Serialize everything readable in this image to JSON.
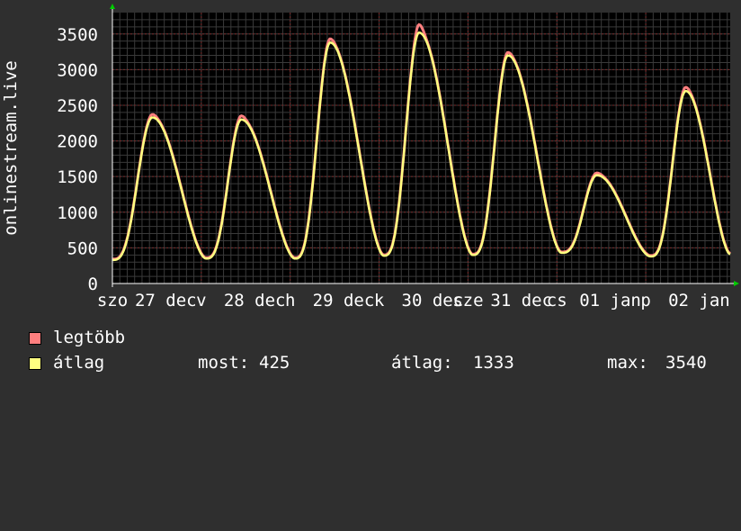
{
  "chart_data": {
    "type": "area",
    "ylabel": "onlinestream.live",
    "ylim": [
      0,
      3800
    ],
    "yticks": [
      0,
      500,
      1000,
      1500,
      2000,
      2500,
      3000,
      3500
    ],
    "x_tick_labels": [
      {
        "day": 0.0,
        "label": "szo"
      },
      {
        "day": 0.6,
        "label": "27 dec"
      },
      {
        "day": 1.0,
        "label": "v"
      },
      {
        "day": 1.6,
        "label": "28 dec"
      },
      {
        "day": 2.0,
        "label": "h"
      },
      {
        "day": 2.6,
        "label": "29 dec"
      },
      {
        "day": 3.0,
        "label": "k"
      },
      {
        "day": 3.6,
        "label": "30 dec"
      },
      {
        "day": 4.0,
        "label": "sze"
      },
      {
        "day": 4.6,
        "label": "31 dec"
      },
      {
        "day": 5.0,
        "label": "cs"
      },
      {
        "day": 5.6,
        "label": "01 jan"
      },
      {
        "day": 6.0,
        "label": "p"
      },
      {
        "day": 6.6,
        "label": "02 jan"
      }
    ],
    "grid": true,
    "x_day_range": [
      0,
      6.95
    ],
    "peaks": [
      {
        "day": 0.45,
        "max": 2360,
        "avg": 2330
      },
      {
        "day": 1.45,
        "max": 2340,
        "avg": 2300
      },
      {
        "day": 2.45,
        "max": 3420,
        "avg": 3380
      },
      {
        "day": 3.45,
        "max": 3620,
        "avg": 3520
      },
      {
        "day": 4.45,
        "max": 3230,
        "avg": 3200
      },
      {
        "day": 5.45,
        "max": 1540,
        "avg": 1520
      },
      {
        "day": 6.45,
        "max": 2740,
        "avg": 2700
      }
    ],
    "troughs": [
      {
        "day": 0.0,
        "value": 330
      },
      {
        "day": 1.05,
        "value": 350
      },
      {
        "day": 2.05,
        "value": 350
      },
      {
        "day": 3.05,
        "value": 390
      },
      {
        "day": 4.05,
        "value": 400
      },
      {
        "day": 5.05,
        "value": 430
      },
      {
        "day": 6.05,
        "value": 380
      },
      {
        "day": 6.95,
        "value": 410
      }
    ],
    "series": [
      {
        "name": "legtöbb",
        "color": "#ff7f7f"
      },
      {
        "name": "átlag",
        "color": "#ffff80"
      }
    ],
    "stats": {
      "most_label": "most:",
      "most_value": "425",
      "atlag_label": "átlag:",
      "atlag_value": "1333",
      "max_label": "max:",
      "max_value": "3540"
    }
  }
}
